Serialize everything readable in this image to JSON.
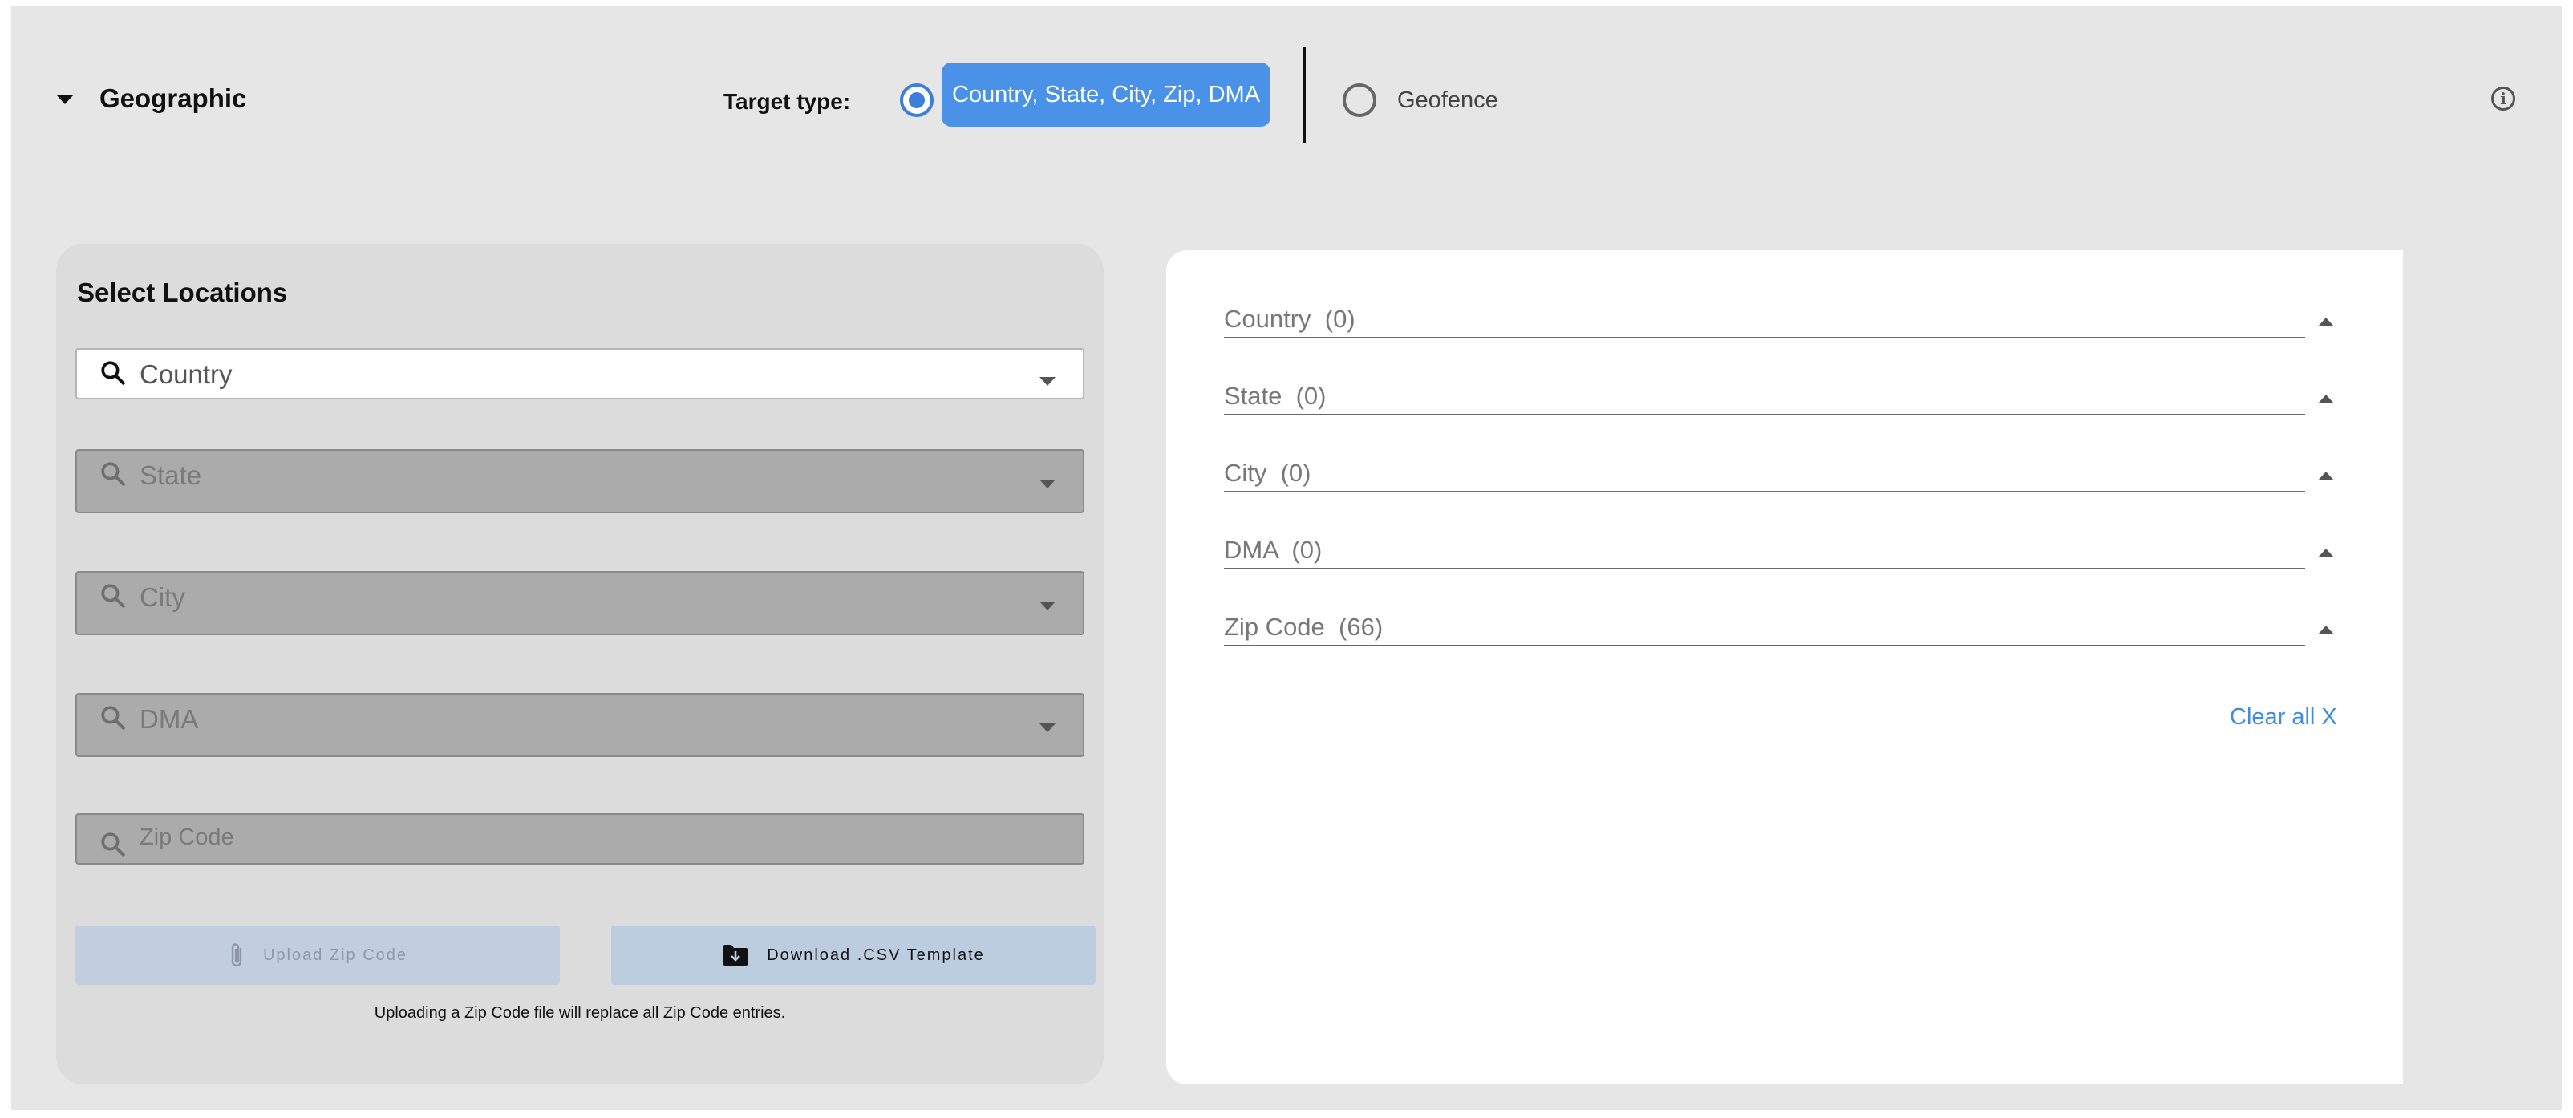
{
  "section": {
    "title": "Geographic"
  },
  "target_type": {
    "label": "Target type:",
    "options": [
      {
        "label": "Country, State, City, Zip, DMA",
        "selected": true
      },
      {
        "label": "Geofence",
        "selected": false
      }
    ]
  },
  "info_icon": {
    "glyph": "i"
  },
  "select_locations": {
    "title": "Select Locations",
    "fields": [
      {
        "placeholder": "Country",
        "enabled": true
      },
      {
        "placeholder": "State",
        "enabled": false
      },
      {
        "placeholder": "City",
        "enabled": false
      },
      {
        "placeholder": "DMA",
        "enabled": false
      },
      {
        "placeholder": "Zip Code",
        "enabled": false
      }
    ],
    "upload_button": "Upload Zip Code",
    "download_button": "Download .CSV Template",
    "note": "Uploading a Zip Code file will replace all Zip Code entries."
  },
  "selected": {
    "groups": [
      {
        "label": "Country  (0)"
      },
      {
        "label": "State  (0)"
      },
      {
        "label": "City  (0)"
      },
      {
        "label": "DMA  (0)"
      },
      {
        "label": "Zip Code  (66)"
      }
    ],
    "clear_all": "Clear all X"
  },
  "colors": {
    "accent": "#4a92e8",
    "link": "#3d8be0",
    "panel": "#e6e6e6"
  }
}
